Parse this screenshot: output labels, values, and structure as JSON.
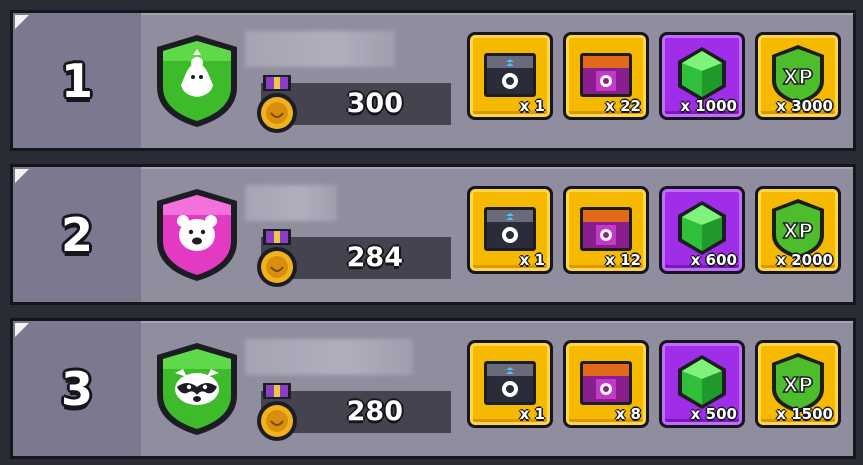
{
  "leaderboard": [
    {
      "rank": "1",
      "badge_icon": "chicken-shield-icon",
      "badge_color": "#3dbb2a",
      "score": "300",
      "rewards": [
        {
          "icon": "dark-chest-icon",
          "qty": "x 1"
        },
        {
          "icon": "magenta-chest-icon",
          "qty": "x 22"
        },
        {
          "icon": "green-gem-icon",
          "qty": "x 1000"
        },
        {
          "icon": "xp-icon",
          "qty": "x 3000"
        }
      ]
    },
    {
      "rank": "2",
      "badge_icon": "bear-shield-icon",
      "badge_color": "#e33ac4",
      "score": "284",
      "rewards": [
        {
          "icon": "dark-chest-icon",
          "qty": "x 1"
        },
        {
          "icon": "magenta-chest-icon",
          "qty": "x 12"
        },
        {
          "icon": "green-gem-icon",
          "qty": "x 600"
        },
        {
          "icon": "xp-icon",
          "qty": "x 2000"
        }
      ]
    },
    {
      "rank": "3",
      "badge_icon": "raccoon-shield-icon",
      "badge_color": "#3dbb2a",
      "score": "280",
      "rewards": [
        {
          "icon": "dark-chest-icon",
          "qty": "x 1"
        },
        {
          "icon": "magenta-chest-icon",
          "qty": "x 8"
        },
        {
          "icon": "green-gem-icon",
          "qty": "x 500"
        },
        {
          "icon": "xp-icon",
          "qty": "x 1500"
        }
      ]
    }
  ],
  "colors": {
    "row_bg": "#8f8d9e",
    "rank_bg": "#7b7890",
    "gold_tile": "#f5b900",
    "purple_tile": "#a02ee8"
  }
}
